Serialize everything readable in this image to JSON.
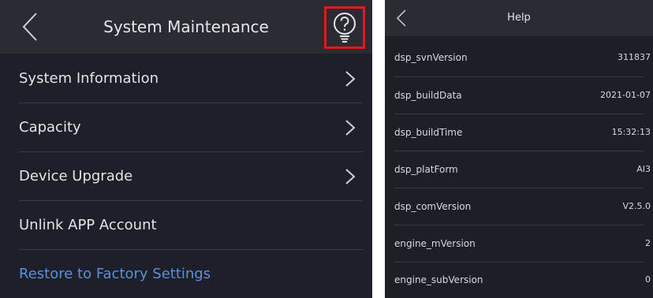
{
  "left_screen": {
    "title": "System Maintenance",
    "items": [
      {
        "label": "System Information"
      },
      {
        "label": "Capacity"
      },
      {
        "label": "Device Upgrade"
      },
      {
        "label": "Unlink APP Account"
      },
      {
        "label": "Restore to Factory Settings"
      }
    ],
    "icons": [
      "back-icon",
      "help-icon",
      "chevron-right-icon"
    ],
    "colors": {
      "background": "#1e1f28",
      "header": "#2a2b33",
      "highlight_box": "#e3191f",
      "link": "#5c8fdc"
    }
  },
  "right_screen": {
    "title": "Help",
    "rows": [
      {
        "key": "dsp_svnVersion",
        "value": "311837"
      },
      {
        "key": "dsp_buildData",
        "value": "2021-01-07"
      },
      {
        "key": "dsp_buildTime",
        "value": "15:32:13"
      },
      {
        "key": "dsp_platForm",
        "value": "AI3"
      },
      {
        "key": "dsp_comVersion",
        "value": "V2.5.0"
      },
      {
        "key": "engine_mVersion",
        "value": "2"
      },
      {
        "key": "engine_subVersion",
        "value": "0"
      }
    ]
  }
}
